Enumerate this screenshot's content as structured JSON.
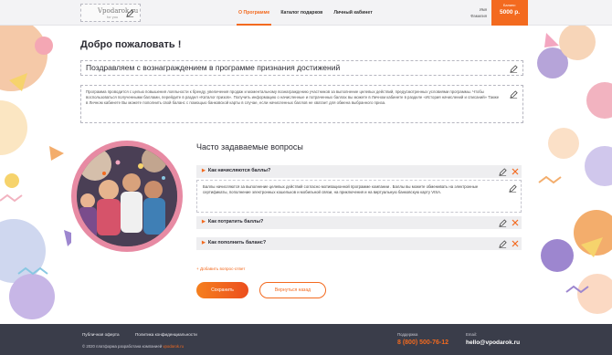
{
  "header": {
    "logo_text": "Vpodarok.ru",
    "logo_sub": "for you",
    "nav": [
      "О Программе",
      "Каталог подарков",
      "Личный кабинет"
    ],
    "user_first": "Имя",
    "user_last": "Фамилия",
    "balance_label": "Баланс:",
    "balance_value": "5000 р."
  },
  "main": {
    "welcome": "Добро пожаловать !",
    "program_title": "Поздравляем с вознаграждением в программе признания достижений",
    "program_description": "Программа проводится с целью повышения лояльности к бренду, увеличения продаж и моментальному вознаграждению участников за выполнение целевых действий, предусмотренных условиями программы. Чтобы воспользоваться полученными баллами, перейдите в раздел «Каталог призов». Получить информацию о начисленные и потраченных баллах вы можете в Личном кабинете в разделе «История начислений и списаний» Также в Личном кабинете Вы можете пополнить свой баланс с помощью банковской карты в случае, если начисленных баллов не хватает для обмена выбранного приза."
  },
  "faq": {
    "title": "Часто задаваемые вопросы",
    "items": [
      {
        "question": "Как начисляются баллы?",
        "answer": "Баллы начисляются за выполнение целевых действий согласно мотивационной программе компании                    . Баллы вы можете обменивать на электронные сертификаты, пополнение электронных кошельков и мобильной связи, на приключения и на виртуальную банковскую карту VISA."
      },
      {
        "question": "Как потратить баллы?"
      },
      {
        "question": "Как пополнить баланс?"
      }
    ],
    "add_label": "+ Добавить вопрос-ответ",
    "save_label": "Сохранить",
    "back_label": "Вернуться назад"
  },
  "footer": {
    "offer": "Публичная оферта",
    "privacy": "Политика конфиденциальности",
    "copyright": "© 2020 платформа разработана компанией",
    "brand": "vpodarok.ru",
    "support_label": "Поддержка",
    "phone": "8 (800) 500-76-12",
    "email_label": "Email:",
    "email": "hello@vpodarok.ru"
  },
  "colors": {
    "accent": "#f36a1f",
    "footer_bg": "#3a3d4a",
    "header_bg": "#f3f3f5"
  },
  "icons": {
    "edit": "pencil-icon",
    "delete": "close-icon",
    "bullet": "chevron-right-icon"
  }
}
